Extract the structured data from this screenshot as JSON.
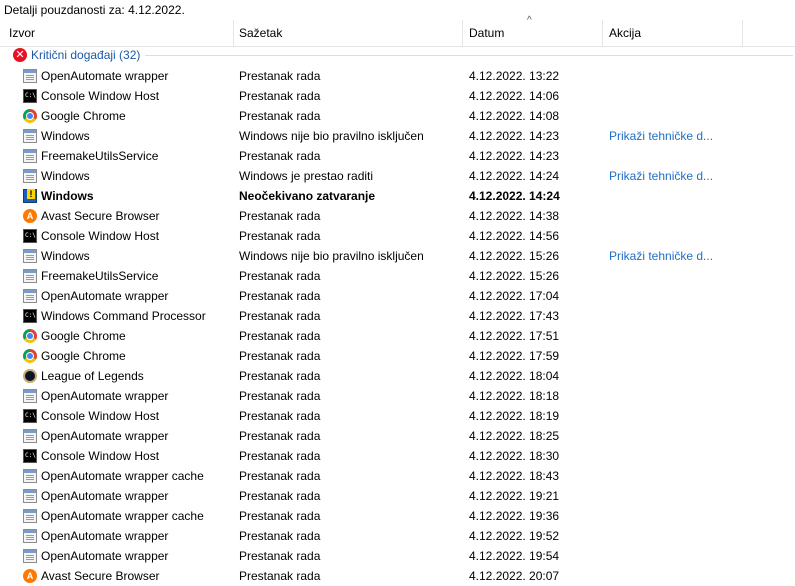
{
  "title": "Detalji pouzdanosti za: 4.12.2022.",
  "columns": {
    "source": "Izvor",
    "summary": "Sažetak",
    "date": "Datum",
    "action": "Akcija"
  },
  "sort_indicator": "^",
  "group": {
    "label": "Kritični događaji (32)",
    "icon": "error-icon",
    "icon_glyph": "✕",
    "color": "#e81123"
  },
  "link_color": "#1e6fc7",
  "rows": [
    {
      "icon": "app",
      "src": "OpenAutomate wrapper",
      "sum": "Prestanak rada",
      "date": "4.12.2022. 13:22",
      "action": ""
    },
    {
      "icon": "console",
      "src": "Console Window Host",
      "sum": "Prestanak rada",
      "date": "4.12.2022. 14:06",
      "action": ""
    },
    {
      "icon": "chrome",
      "src": "Google Chrome",
      "sum": "Prestanak rada",
      "date": "4.12.2022. 14:08",
      "action": ""
    },
    {
      "icon": "app",
      "src": "Windows",
      "sum": "Windows nije bio pravilno isključen",
      "date": "4.12.2022. 14:23",
      "action": "Prikaži tehničke d..."
    },
    {
      "icon": "app",
      "src": "FreemakeUtilsService",
      "sum": "Prestanak rada",
      "date": "4.12.2022. 14:23",
      "action": ""
    },
    {
      "icon": "app",
      "src": "Windows",
      "sum": "Windows je prestao raditi",
      "date": "4.12.2022. 14:24",
      "action": "Prikaži tehničke d..."
    },
    {
      "icon": "windows",
      "src": "Windows",
      "sum": "Neočekivano zatvaranje",
      "date": "4.12.2022. 14:24",
      "action": "",
      "bold": true
    },
    {
      "icon": "avast",
      "src": "Avast Secure Browser",
      "sum": "Prestanak rada",
      "date": "4.12.2022. 14:38",
      "action": ""
    },
    {
      "icon": "console",
      "src": "Console Window Host",
      "sum": "Prestanak rada",
      "date": "4.12.2022. 14:56",
      "action": ""
    },
    {
      "icon": "app",
      "src": "Windows",
      "sum": "Windows nije bio pravilno isključen",
      "date": "4.12.2022. 15:26",
      "action": "Prikaži tehničke d..."
    },
    {
      "icon": "app",
      "src": "FreemakeUtilsService",
      "sum": "Prestanak rada",
      "date": "4.12.2022. 15:26",
      "action": ""
    },
    {
      "icon": "app",
      "src": "OpenAutomate wrapper",
      "sum": "Prestanak rada",
      "date": "4.12.2022. 17:04",
      "action": ""
    },
    {
      "icon": "console",
      "src": "Windows Command Processor",
      "sum": "Prestanak rada",
      "date": "4.12.2022. 17:43",
      "action": ""
    },
    {
      "icon": "chrome",
      "src": "Google Chrome",
      "sum": "Prestanak rada",
      "date": "4.12.2022. 17:51",
      "action": ""
    },
    {
      "icon": "chrome",
      "src": "Google Chrome",
      "sum": "Prestanak rada",
      "date": "4.12.2022. 17:59",
      "action": ""
    },
    {
      "icon": "lol",
      "src": "League of Legends",
      "sum": "Prestanak rada",
      "date": "4.12.2022. 18:04",
      "action": ""
    },
    {
      "icon": "app",
      "src": "OpenAutomate wrapper",
      "sum": "Prestanak rada",
      "date": "4.12.2022. 18:18",
      "action": ""
    },
    {
      "icon": "console",
      "src": "Console Window Host",
      "sum": "Prestanak rada",
      "date": "4.12.2022. 18:19",
      "action": ""
    },
    {
      "icon": "app",
      "src": "OpenAutomate wrapper",
      "sum": "Prestanak rada",
      "date": "4.12.2022. 18:25",
      "action": ""
    },
    {
      "icon": "console",
      "src": "Console Window Host",
      "sum": "Prestanak rada",
      "date": "4.12.2022. 18:30",
      "action": ""
    },
    {
      "icon": "app",
      "src": "OpenAutomate wrapper cache",
      "sum": "Prestanak rada",
      "date": "4.12.2022. 18:43",
      "action": ""
    },
    {
      "icon": "app",
      "src": "OpenAutomate wrapper",
      "sum": "Prestanak rada",
      "date": "4.12.2022. 19:21",
      "action": ""
    },
    {
      "icon": "app",
      "src": "OpenAutomate wrapper cache",
      "sum": "Prestanak rada",
      "date": "4.12.2022. 19:36",
      "action": ""
    },
    {
      "icon": "app",
      "src": "OpenAutomate wrapper",
      "sum": "Prestanak rada",
      "date": "4.12.2022. 19:52",
      "action": ""
    },
    {
      "icon": "app",
      "src": "OpenAutomate wrapper",
      "sum": "Prestanak rada",
      "date": "4.12.2022. 19:54",
      "action": ""
    },
    {
      "icon": "avast",
      "src": "Avast Secure Browser",
      "sum": "Prestanak rada",
      "date": "4.12.2022. 20:07",
      "action": ""
    }
  ]
}
